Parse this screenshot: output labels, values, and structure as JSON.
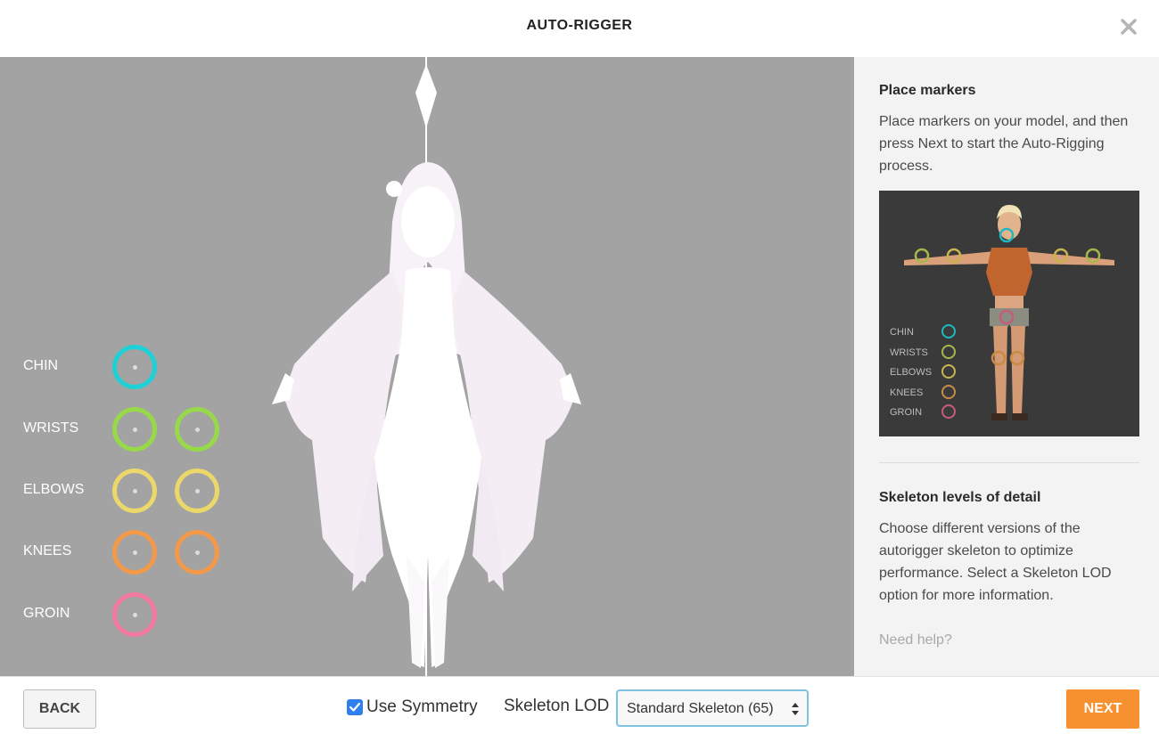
{
  "header": {
    "title": "AUTO-RIGGER"
  },
  "markers": [
    {
      "id": "chin",
      "label": "CHIN",
      "color": "#1fd0d6",
      "count": 1
    },
    {
      "id": "wrists",
      "label": "WRISTS",
      "color": "#98d94a",
      "count": 2
    },
    {
      "id": "elbows",
      "label": "ELBOWS",
      "color": "#ecd76a",
      "count": 2
    },
    {
      "id": "knees",
      "label": "KNEES",
      "color": "#f2994a",
      "count": 2
    },
    {
      "id": "groin",
      "label": "GROIN",
      "color": "#f27a9e",
      "count": 1
    }
  ],
  "side": {
    "place_title": "Place markers",
    "place_text": "Place markers on your model, and then press Next to start the Auto-Rigging process.",
    "preview_legend": [
      {
        "label": "CHIN",
        "color": "#1fb8c2"
      },
      {
        "label": "WRISTS",
        "color": "#a5b84a"
      },
      {
        "label": "ELBOWS",
        "color": "#c9b64e"
      },
      {
        "label": "KNEES",
        "color": "#c98a45"
      },
      {
        "label": "GROIN",
        "color": "#c45c7a"
      }
    ],
    "lod_title": "Skeleton levels of detail",
    "lod_text": "Choose different versions of the autorigger skeleton to optimize performance. Select a Skeleton LOD option for more information.",
    "help_link": "Need help?"
  },
  "footer": {
    "back_label": "BACK",
    "symmetry_label": "Use Symmetry",
    "symmetry_checked": true,
    "lod_label": "Skeleton LOD",
    "lod_value": "Standard Skeleton (65)",
    "next_label": "NEXT"
  },
  "colors": {
    "accent": "#f7912f",
    "checkbox": "#2f80ed",
    "viewport_bg": "#a3a3a3"
  }
}
